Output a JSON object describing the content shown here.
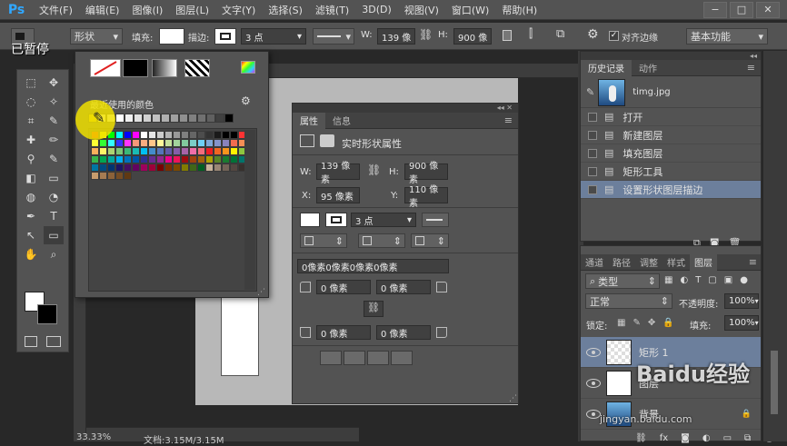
{
  "app": {
    "logo": "Ps",
    "overlay_text": "已暂停"
  },
  "menu": {
    "items": [
      "文件(F)",
      "编辑(E)",
      "图像(I)",
      "图层(L)",
      "文字(Y)",
      "选择(S)",
      "滤镜(T)",
      "3D(D)",
      "视图(V)",
      "窗口(W)",
      "帮助(H)"
    ]
  },
  "window": {
    "minimize": "−",
    "restore": "□",
    "close": "✕"
  },
  "options": {
    "mode": "形状",
    "fill_label": "填充:",
    "stroke_label": "描边:",
    "stroke_width": "3 点",
    "w_label": "W:",
    "w_value": "139 像",
    "h_label": "H:",
    "h_value": "900 像",
    "align_edges_label": "对齐边缘",
    "workspace": "基本功能",
    "align_edges_checked": true
  },
  "swatch_popup": {
    "recent_label": "最近使用的颜色",
    "gear": "⚙"
  },
  "properties": {
    "tabs": [
      "属性",
      "信息"
    ],
    "header": "实时形状属性",
    "w_label": "W:",
    "w_value": "139 像素",
    "h_label": "H:",
    "h_value": "900 像素",
    "x_label": "X:",
    "x_value": "95 像素",
    "y_label": "Y:",
    "y_value": "110 像素",
    "stroke_width": "3 点",
    "corners_summary": "0像素0像素0像素0像素",
    "corner_tl": "0 像素",
    "corner_tr": "0 像素",
    "corner_bl": "0 像素",
    "corner_br": "0 像素"
  },
  "history": {
    "tabs": [
      "历史记录",
      "动作"
    ],
    "snapshot": "timg.jpg",
    "items": [
      "打开",
      "新建图层",
      "填充图层",
      "矩形工具",
      "设置形状图层描边"
    ]
  },
  "layers": {
    "tabs": [
      "通道",
      "路径",
      "调整",
      "样式",
      "图层"
    ],
    "filter": "类型",
    "blend_mode": "正常",
    "opacity_label": "不透明度:",
    "opacity": "100%",
    "lock_label": "锁定:",
    "fill_label": "填充:",
    "fill": "100%",
    "items": [
      {
        "name": "矩形 1"
      },
      {
        "name": "图层"
      },
      {
        "name": "背景"
      }
    ]
  },
  "status": {
    "zoom": "33.33%",
    "doc": "文档:3.15M/3.15M"
  },
  "watermark": {
    "text": "Baidu经验",
    "sub": "jingyan.baidu.com"
  },
  "colors": {
    "accent": "#31a8ff",
    "highlight": "#f0e000",
    "selection": "#6c7f9c"
  }
}
